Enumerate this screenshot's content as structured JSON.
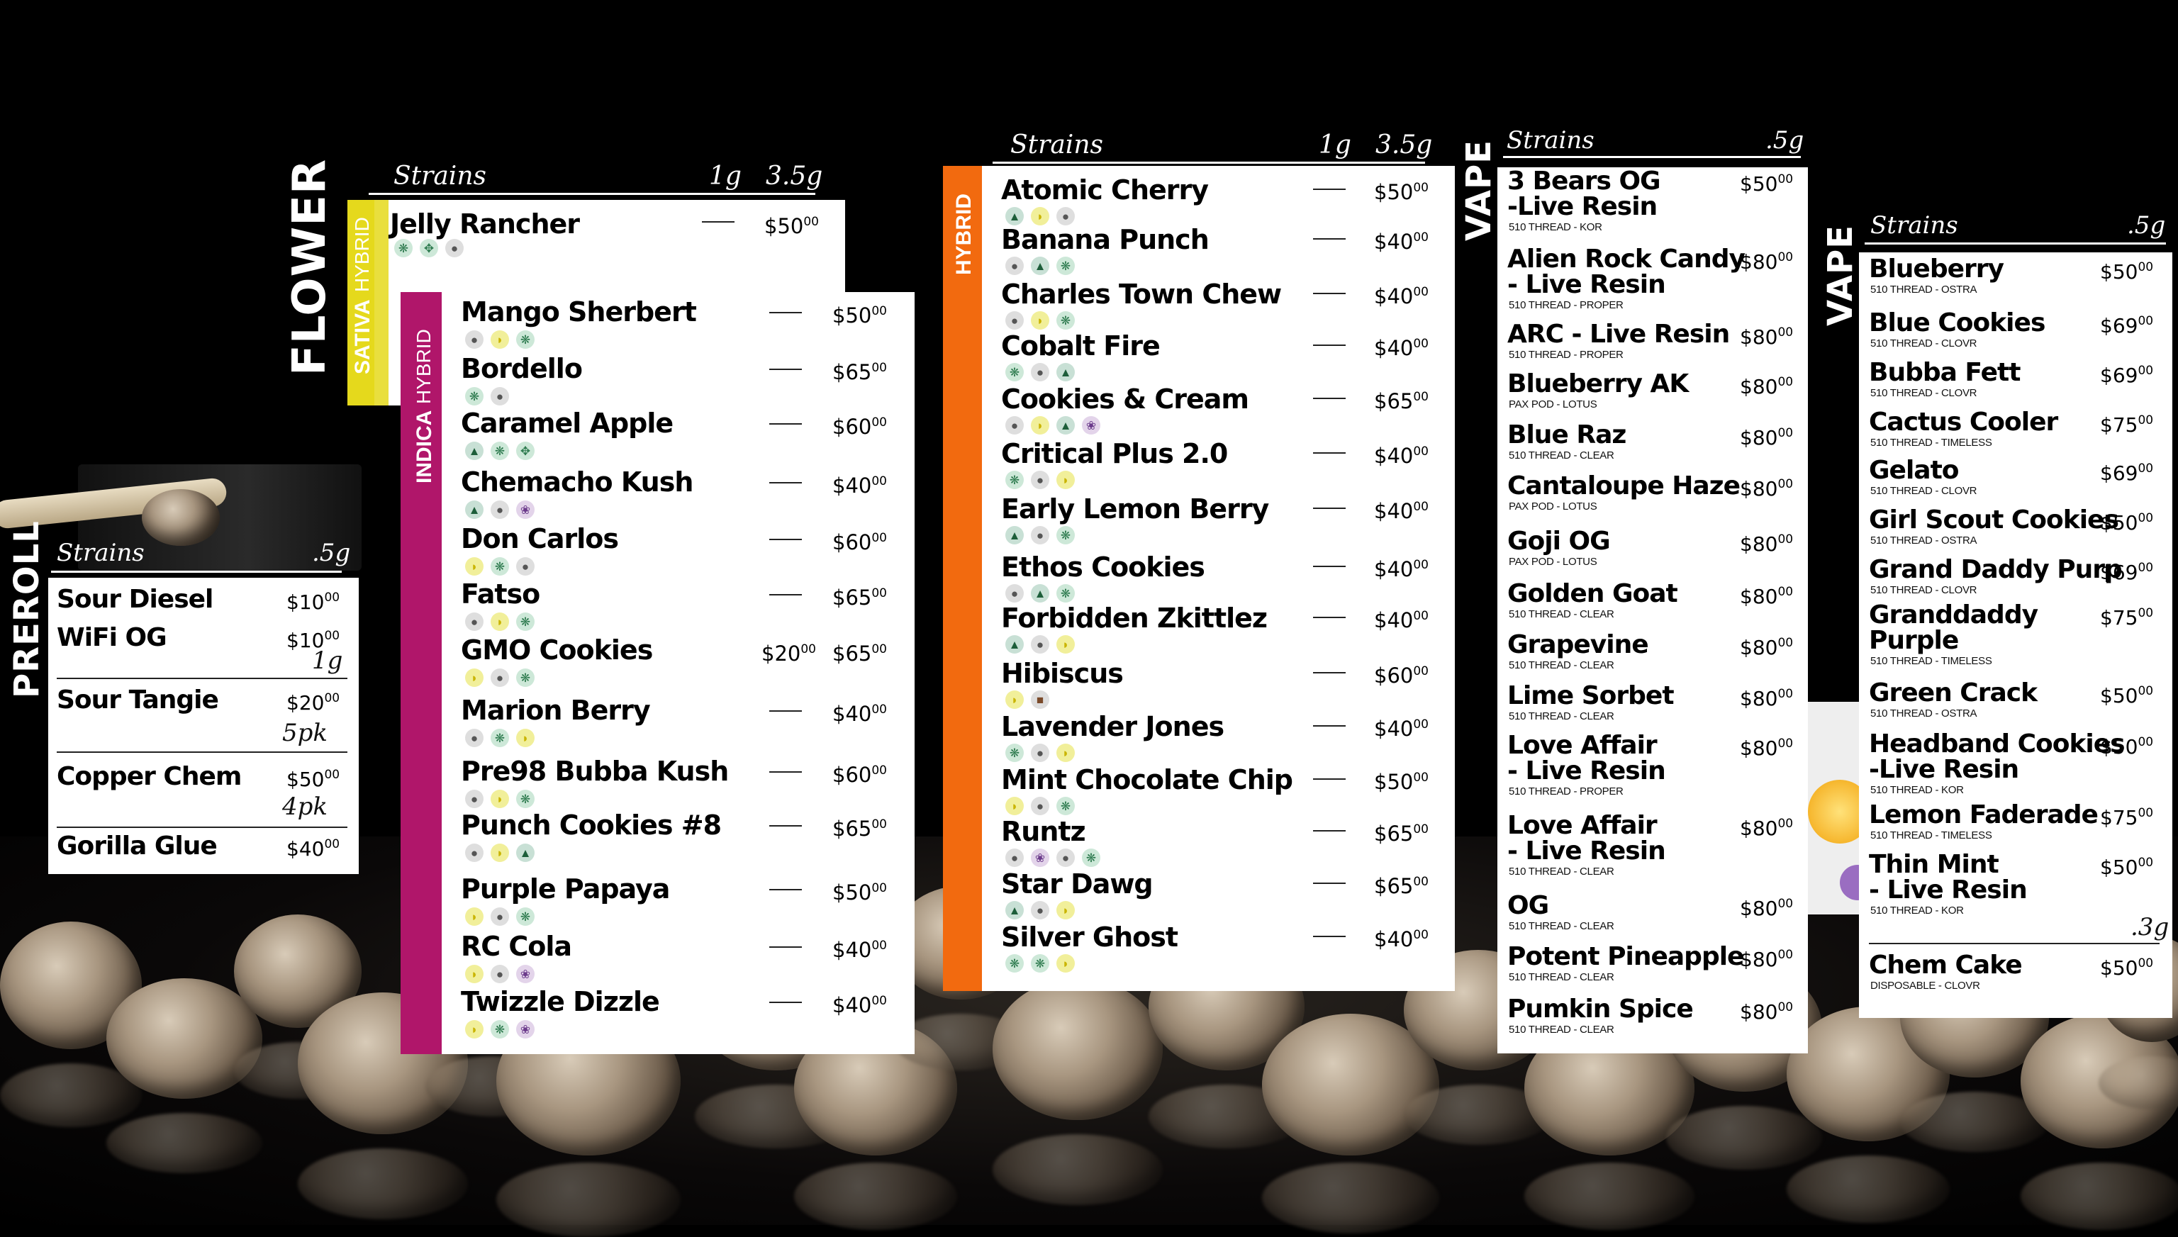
{
  "colors": {
    "sativa": "#e5d91c",
    "hybrid_flower": "#e5d91c",
    "indica": "#b0166a",
    "hybrid": "#f26a0f",
    "bg": "#000000"
  },
  "labels": {
    "flower": "FLOWER",
    "preroll": "PREROLL",
    "vape1": "VAPE",
    "vape2": "VAPE"
  },
  "sativa_panel": {
    "header": {
      "strains": "Strains",
      "col1": "1g",
      "col2": "3.5g"
    },
    "stripe_labels": {
      "a": "SATIVA",
      "b": "HYBRID"
    },
    "items": [
      {
        "name": "Jelly Rancher",
        "price1_main": "$50",
        "price1_cents": "00",
        "icons": [
          "pepper-icon",
          "leaf-icon",
          "pepper-icon"
        ]
      }
    ]
  },
  "indica_panel": {
    "stripe_labels": {
      "a": "INDICA",
      "b": "HYBRID"
    },
    "items": [
      {
        "name": "Mango Sherbert",
        "p": "$50",
        "c": "00",
        "icons": [
          "pepper",
          "lemon",
          "leaf"
        ]
      },
      {
        "name": "Bordello",
        "p": "$65",
        "c": "00",
        "icons": [
          "leaf",
          "pepper"
        ]
      },
      {
        "name": "Caramel Apple",
        "p": "$60",
        "c": "00",
        "icons": [
          "tree",
          "leaf",
          "leafp"
        ]
      },
      {
        "name": "Chemacho Kush",
        "p": "$40",
        "c": "00",
        "icons": [
          "tree",
          "pepper",
          "grape"
        ]
      },
      {
        "name": "Don Carlos",
        "p": "$60",
        "c": "00",
        "icons": [
          "lemon",
          "leaf",
          "pepper"
        ]
      },
      {
        "name": "Fatso",
        "p": "$65",
        "c": "00",
        "icons": [
          "pepper",
          "lemon",
          "leaf"
        ]
      },
      {
        "name": "GMO Cookies",
        "p0": "$20",
        "c0": "00",
        "p": "$65",
        "c": "00",
        "icons": [
          "lemon",
          "pepper",
          "leaf"
        ]
      },
      {
        "name": "Marion Berry",
        "p": "$40",
        "c": "00",
        "icons": [
          "pepper",
          "leaf",
          "lemon"
        ]
      },
      {
        "name": "Pre98 Bubba Kush",
        "p": "$60",
        "c": "00",
        "icons": [
          "pepper",
          "lemon",
          "leaf"
        ]
      },
      {
        "name": "Punch Cookies #8",
        "p": "$65",
        "c": "00",
        "icons": [
          "pepper",
          "lemon",
          "tree"
        ]
      },
      {
        "name": "Purple Papaya",
        "p": "$50",
        "c": "00",
        "icons": [
          "lemon",
          "pepper",
          "leaf"
        ]
      },
      {
        "name": "RC Cola",
        "p": "$40",
        "c": "00",
        "icons": [
          "lemon",
          "pepper",
          "grape"
        ]
      },
      {
        "name": "Twizzle Dizzle",
        "p": "$40",
        "c": "00",
        "icons": [
          "lemon",
          "leaf",
          "grape"
        ]
      }
    ]
  },
  "hybrid_panel": {
    "header": {
      "strains": "Strains",
      "col1": "1g",
      "col2": "3.5g"
    },
    "stripe_label": "HYBRID",
    "items": [
      {
        "name": "Atomic Cherry",
        "p": "$50",
        "c": "00",
        "icons": [
          "tree",
          "lemon",
          "pepper"
        ]
      },
      {
        "name": "Banana Punch",
        "p": "$40",
        "c": "00",
        "icons": [
          "pepper",
          "tree",
          "leaf"
        ]
      },
      {
        "name": "Charles Town Chew",
        "p": "$40",
        "c": "00",
        "icons": [
          "pepper",
          "lemon",
          "leaf"
        ]
      },
      {
        "name": "Cobalt Fire",
        "p": "$40",
        "c": "00",
        "icons": [
          "leaf",
          "pepper",
          "tree"
        ]
      },
      {
        "name": "Cookies & Cream",
        "p": "$65",
        "c": "00",
        "icons": [
          "pepper",
          "lemon",
          "tree",
          "grape"
        ]
      },
      {
        "name": "Critical Plus 2.0",
        "p": "$40",
        "c": "00",
        "icons": [
          "leaf",
          "pepper",
          "lemon"
        ]
      },
      {
        "name": "Early Lemon Berry",
        "p": "$40",
        "c": "00",
        "icons": [
          "tree",
          "pepper",
          "leaf"
        ]
      },
      {
        "name": "Ethos Cookies",
        "p": "$40",
        "c": "00",
        "icons": [
          "pepper",
          "tree",
          "leaf"
        ]
      },
      {
        "name": "Forbidden Zkittlez",
        "p": "$40",
        "c": "00",
        "icons": [
          "tree",
          "pepper",
          "lemon"
        ]
      },
      {
        "name": "Hibiscus",
        "p": "$60",
        "c": "00",
        "icons": [
          "lemon",
          "berry"
        ]
      },
      {
        "name": "Lavender Jones",
        "p": "$40",
        "c": "00",
        "icons": [
          "leaf",
          "pepper",
          "lemon"
        ]
      },
      {
        "name": "Mint Chocolate Chip",
        "p": "$50",
        "c": "00",
        "icons": [
          "lemon",
          "pepper",
          "leaf"
        ]
      },
      {
        "name": "Runtz",
        "p": "$65",
        "c": "00",
        "icons": [
          "pepper",
          "grape",
          "pepper",
          "leaf"
        ]
      },
      {
        "name": "Star Dawg",
        "p": "$65",
        "c": "00",
        "icons": [
          "tree",
          "pepper",
          "lemon"
        ]
      },
      {
        "name": "Silver Ghost",
        "p": "$40",
        "c": "00",
        "icons": [
          "leaf",
          "leaf",
          "lemon"
        ]
      }
    ]
  },
  "preroll_panel": {
    "header": {
      "strains": "Strains",
      "col1": ".5g"
    },
    "items": [
      {
        "name": "Sour Diesel",
        "p": "$10",
        "c": "00"
      },
      {
        "name": "WiFi OG",
        "p": "$10",
        "c": "00"
      },
      {
        "name": "Sour Tangie",
        "p": "$20",
        "c": "00"
      },
      {
        "name": "Copper Chem",
        "p": "$50",
        "c": "00"
      },
      {
        "name": "Gorilla Glue",
        "p": "$40",
        "c": "00"
      }
    ],
    "units": {
      "u1": "1g",
      "u2": "5pk",
      "u3": "4pk"
    }
  },
  "vape1_panel": {
    "header": {
      "strains": "Strains",
      "col1": ".5g"
    },
    "items": [
      {
        "name": "3 Bears OG",
        "name2": "-Live Resin",
        "sub": "510 THREAD - KOR",
        "p": "$50",
        "c": "00"
      },
      {
        "name": "Alien Rock Candy",
        "name2": "- Live Resin",
        "sub": "510 THREAD - PROPER",
        "p": "$80",
        "c": "00"
      },
      {
        "name": "ARC - Live Resin",
        "sub": "510 THREAD - PROPER",
        "p": "$80",
        "c": "00"
      },
      {
        "name": "Blueberry AK",
        "sub": "PAX POD - LOTUS",
        "p": "$80",
        "c": "00"
      },
      {
        "name": "Blue Raz",
        "sub": "510 THREAD - CLEAR",
        "p": "$80",
        "c": "00"
      },
      {
        "name": "Cantaloupe Haze",
        "sub": "PAX POD - LOTUS",
        "p": "$80",
        "c": "00"
      },
      {
        "name": "Goji OG",
        "sub": "PAX POD - LOTUS",
        "p": "$80",
        "c": "00"
      },
      {
        "name": "Golden Goat",
        "sub": "510 THREAD - CLEAR",
        "p": "$80",
        "c": "00"
      },
      {
        "name": "Grapevine",
        "sub": "510 THREAD - CLEAR",
        "p": "$80",
        "c": "00"
      },
      {
        "name": "Lime Sorbet",
        "sub": "510 THREAD - CLEAR",
        "p": "$80",
        "c": "00"
      },
      {
        "name": "Love Affair",
        "name2": "- Live Resin",
        "sub": "510 THREAD - PROPER",
        "p": "$80",
        "c": "00"
      },
      {
        "name": "Love Affair",
        "name2": "- Live Resin",
        "sub": "510 THREAD - CLEAR",
        "p": "$80",
        "c": "00"
      },
      {
        "name": "OG",
        "sub": "510 THREAD - CLEAR",
        "p": "$80",
        "c": "00"
      },
      {
        "name": "Potent Pineapple",
        "sub": "510 THREAD - CLEAR",
        "p": "$80",
        "c": "00"
      },
      {
        "name": "Pumkin Spice",
        "sub": "510 THREAD - CLEAR",
        "p": "$80",
        "c": "00"
      }
    ]
  },
  "vape2_panel": {
    "header": {
      "strains": "Strains",
      "col1": ".5g"
    },
    "items": [
      {
        "name": "Blueberry",
        "sub": "510 THREAD - OSTRA",
        "p": "$50",
        "c": "00"
      },
      {
        "name": "Blue Cookies",
        "sub": "510 THREAD - CLOVR",
        "p": "$69",
        "c": "00"
      },
      {
        "name": "Bubba Fett",
        "sub": "510 THREAD - CLOVR",
        "p": "$69",
        "c": "00"
      },
      {
        "name": "Cactus Cooler",
        "sub": "510 THREAD - TIMELESS",
        "p": "$75",
        "c": "00"
      },
      {
        "name": "Gelato",
        "sub": "510 THREAD - CLOVR",
        "p": "$69",
        "c": "00"
      },
      {
        "name": "Girl Scout Cookies",
        "sub": "510 THREAD - OSTRA",
        "p": "$50",
        "c": "00"
      },
      {
        "name": "Grand Daddy Purp",
        "sub": "510 THREAD - CLOVR",
        "p": "$69",
        "c": "00"
      },
      {
        "name": "Granddaddy",
        "name2": "Purple",
        "sub": "510 THREAD - TIMELESS",
        "p": "$75",
        "c": "00"
      },
      {
        "name": "Green Crack",
        "sub": "510 THREAD - OSTRA",
        "p": "$50",
        "c": "00"
      },
      {
        "name": "Headband Cookies",
        "name2": "-Live Resin",
        "sub": "510 THREAD - KOR",
        "p": "$50",
        "c": "00"
      },
      {
        "name": "Lemon Faderade",
        "sub": "510 THREAD - TIMELESS",
        "p": "$75",
        "c": "00"
      },
      {
        "name": "Thin Mint",
        "name2": "- Live Resin",
        "sub": "510 THREAD - KOR",
        "p": "$50",
        "c": "00"
      },
      {
        "name": "Chem Cake",
        "sub": "DISPOSABLE - CLOVR",
        "p": "$50",
        "c": "00"
      }
    ],
    "unit": ".3g"
  }
}
